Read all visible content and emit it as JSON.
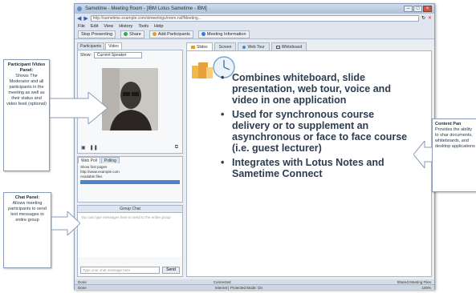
{
  "browser": {
    "title": "Sametime - Meeting Room - [IBM Lotus Sametime - IBM]",
    "url": "http://sametime.example.com/stmeetings/room.nsf/Meeting...",
    "menu": [
      "File",
      "Edit",
      "View",
      "History",
      "Tools",
      "Help"
    ],
    "toolbar": [
      "Stop Presenting",
      "Share",
      "Add Participants",
      "Meeting Information"
    ]
  },
  "left_panel": {
    "tabs": [
      "Participants",
      "Video"
    ],
    "show_label": "Show:",
    "show_value": "Current Speaker",
    "participant_tabs": [
      "Web Poll",
      "Polling"
    ],
    "participants": [
      "Show first pages",
      "http://www.example.com",
      "Available files"
    ],
    "chat": {
      "header": "Group Chat",
      "placeholder_area": "You can type messages here to send to the entire group",
      "input_placeholder": "Type your chat message here",
      "send": "Send"
    }
  },
  "content": {
    "tabs": [
      "Slides",
      "Screen",
      "Web Tour",
      "Whiteboard"
    ],
    "bullets": [
      "Combines whiteboard, slide presentation, web tour, voice and video in one application",
      "Used for synchronous course delivery or to supplement an asynchronous or face to face course (i.e. guest lecturer)",
      "Integrates with Lotus Notes and Sametime Connect"
    ]
  },
  "status": {
    "app_left": "Done",
    "app_center": "Connected",
    "app_right": "Shared Meeting Files",
    "browser_left": "Done",
    "browser_zone": "Internet | Protected Mode: On",
    "zoom": "100%"
  },
  "callouts": {
    "participant_title": "Participant /Video Panel:",
    "participant_body": "Shows The Moderator and all participants in the meeting as well as their status and video feed (optional)",
    "chat_title": "Chat Panel:",
    "chat_body": "Allows meeting participants to send text messages to entire group",
    "content_title": "Content Pan",
    "content_body": "Provides the ability to shar documents, whiteboards, and desktop applications"
  },
  "colors": {
    "accent": "#4a86c9",
    "slide_text": "#2d3d50"
  }
}
